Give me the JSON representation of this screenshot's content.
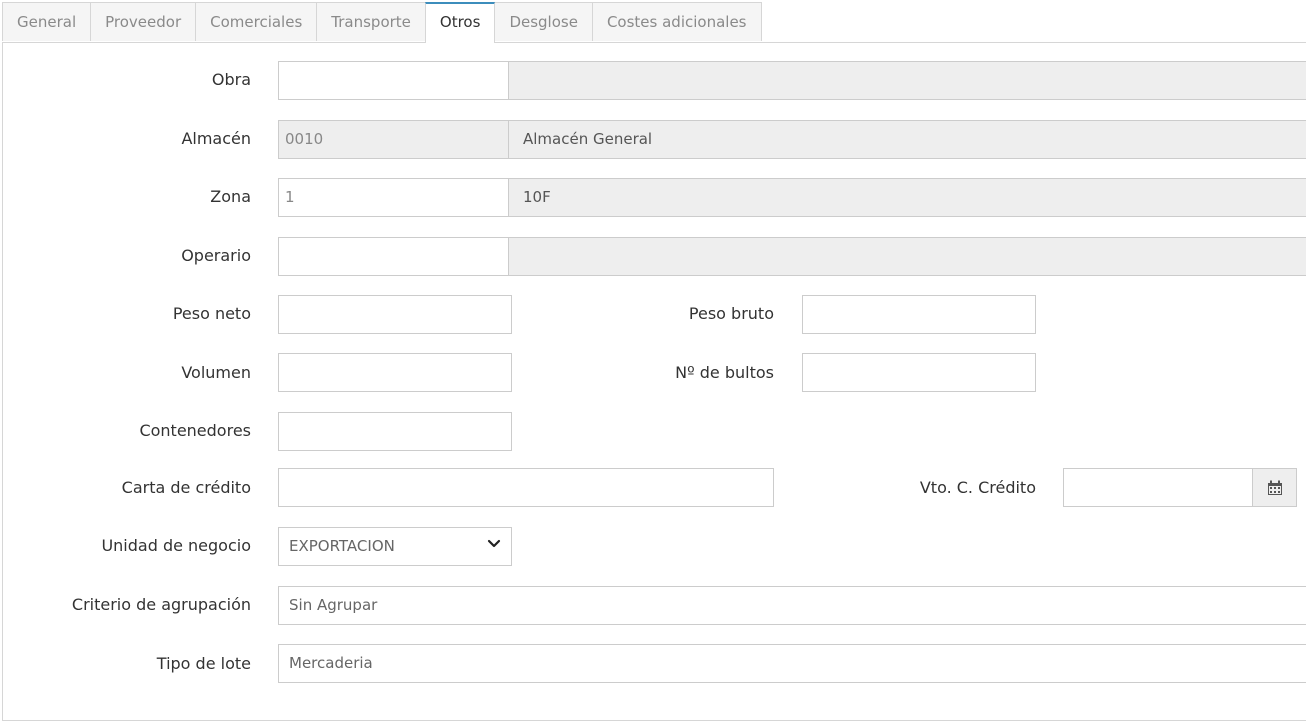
{
  "tabs": [
    {
      "label": "General"
    },
    {
      "label": "Proveedor"
    },
    {
      "label": "Comerciales"
    },
    {
      "label": "Transporte"
    },
    {
      "label": "Otros"
    },
    {
      "label": "Desglose"
    },
    {
      "label": "Costes adicionales"
    }
  ],
  "active_tab": "Otros",
  "form": {
    "obra": {
      "label": "Obra",
      "code": "",
      "description": ""
    },
    "almacen": {
      "label": "Almacén",
      "code": "0010",
      "description": "Almacén General"
    },
    "zona": {
      "label": "Zona",
      "code": "1",
      "description": "10F"
    },
    "operario": {
      "label": "Operario",
      "code": "",
      "description": ""
    },
    "peso_neto": {
      "label": "Peso neto",
      "value": ""
    },
    "peso_bruto": {
      "label": "Peso bruto",
      "value": ""
    },
    "volumen": {
      "label": "Volumen",
      "value": ""
    },
    "num_bultos": {
      "label": "Nº de bultos",
      "value": ""
    },
    "contenedores": {
      "label": "Contenedores",
      "value": ""
    },
    "carta_credito": {
      "label": "Carta de crédito",
      "value": ""
    },
    "vto_credito": {
      "label": "Vto. C. Crédito",
      "value": "",
      "icon": "calendar-icon"
    },
    "unidad_negocio": {
      "label": "Unidad de negocio",
      "value": "EXPORTACION",
      "icon": "chevron-down-icon"
    },
    "criterio_agrupacion": {
      "label": "Criterio de agrupación",
      "value": "Sin Agrupar"
    },
    "tipo_lote": {
      "label": "Tipo de lote",
      "value": "Mercaderia"
    }
  },
  "colors": {
    "active_tab_accent": "#3c8dbc",
    "readonly_bg": "#eeeeee",
    "border": "#cccccc"
  }
}
